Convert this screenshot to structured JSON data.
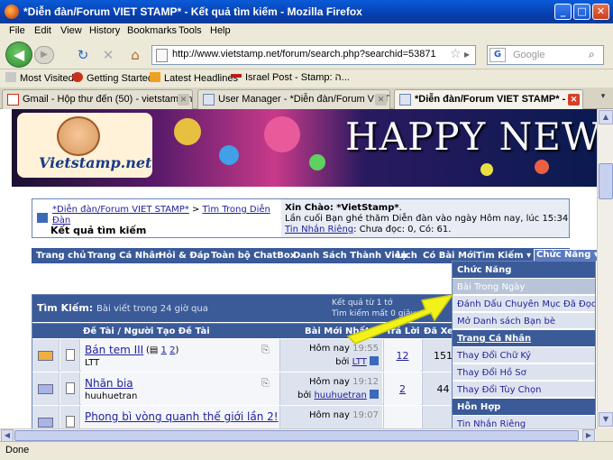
{
  "window": {
    "title": "*Diễn đàn/Forum VIET STAMP* - Kết quả tìm kiếm - Mozilla Firefox"
  },
  "menu": [
    "File",
    "Edit",
    "View",
    "History",
    "Bookmarks",
    "Tools",
    "Help"
  ],
  "nav": {
    "url": "http://www.vietstamp.net/forum/search.php?searchid=53871",
    "search_placeholder": "Google"
  },
  "bookmarks": [
    "Most Visited",
    "Getting Started",
    "Latest Headlines",
    "Israel Post - Stamp: ה..."
  ],
  "tabs": [
    {
      "label": "Gmail - Hộp thư đến (50) - vietstamp.n..."
    },
    {
      "label": "User Manager - *Diễn đàn/Forum VIET ..."
    },
    {
      "label": "*Diễn đàn/Forum VIET STAMP* - ..."
    }
  ],
  "banner": {
    "site": "Vietstamp.net",
    "greeting": "HAPPY NEW"
  },
  "breadcrumb": {
    "forum": "*Diễn đàn/Forum VIET STAMP*",
    "sep": " > ",
    "section": "Tìm Trong Diễn Đàn",
    "current": "Kết quả tìm kiếm"
  },
  "user": {
    "hello_label": "Xin Chào: ",
    "name": "*VietStamp*",
    "hello_end": ".",
    "last_visit": "Lần cuối Bạn ghé thăm Diễn đàn vào ngày Hôm nay, lúc 15:34",
    "pm_link": "Tin Nhắn Riêng",
    "pm_status": ": Chưa đọc: 0, Có: 61."
  },
  "navstrip": [
    "Trang chủ",
    "Trang Cá Nhân",
    "Hỏi & Đáp",
    "Toàn bộ ChatBox",
    "Danh Sách Thành Viên",
    "Lịch",
    "Có Bài Mới",
    "Tìm Kiếm ▾",
    "Chức Năng ▾"
  ],
  "results": {
    "title": "Tìm Kiếm: ",
    "subtitle": "Bài viết trong 24 giờ qua",
    "info1": "Kết quả từ 1 tớ",
    "info2": "Tìm kiếm mất 0 giây; p",
    "columns": [
      "Đề Tài / Người Tạo Đề Tài",
      "Bài Mới Nhất",
      "Trả Lời",
      "Đã Xem"
    ],
    "rows": [
      {
        "title": "Bán tem III",
        "author": "LTT",
        "pages_prefix": "(",
        "page1": "1",
        "page2": "2",
        "pages_suffix": ")",
        "time_day": "Hôm nay",
        "time": "19:55",
        "by": "bởi",
        "last_user": "LTT",
        "replies": "12",
        "views": "151"
      },
      {
        "title": "Nhãn bia",
        "author": "huuhuetran",
        "time_day": "Hôm nay",
        "time": "19:12",
        "by": "bởi",
        "last_user": "huuhuetran",
        "replies": "2",
        "views": "44"
      },
      {
        "title": "Phong bì vòng quanh thế giới lần 2!",
        "time_day": "Hôm nay",
        "time": "19:07"
      }
    ]
  },
  "dropdown": {
    "head1": "Chức Năng",
    "items1": [
      "Bài Trong Ngày",
      "Đánh Dấu Chuyên Mục Đã Đọc",
      "Mở Danh sách Bạn bè"
    ],
    "head2": "Trang Cá Nhân",
    "items2": [
      "Thay Đổi Chữ Ký",
      "Thay Đổi Hồ Sơ",
      "Thay Đổi Tùy Chọn"
    ],
    "head3": "Hỗn Hợp",
    "items3": [
      "Tin Nhắn Riêng"
    ]
  },
  "status": "Done",
  "colors": {
    "forum_blue": "#3a5a98",
    "link": "#22229c",
    "highlight_arrow": "#f2f21a"
  }
}
